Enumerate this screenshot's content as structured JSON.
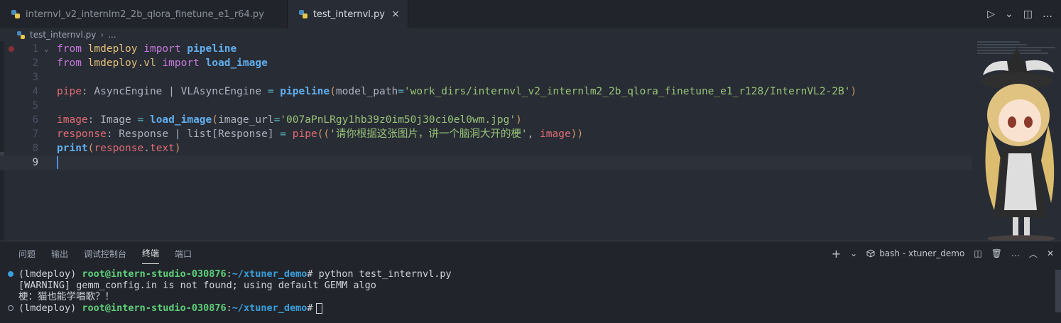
{
  "tabs": [
    {
      "label": "internvl_v2_internlm2_2b_qlora_finetune_e1_r64.py",
      "active": false
    },
    {
      "label": "test_internvl.py",
      "active": true
    }
  ],
  "tab_actions": {
    "run": "▷",
    "run_menu": "⌄",
    "split": "◫",
    "more": "…"
  },
  "tab_close": "×",
  "breadcrumb": {
    "file": "test_internvl.py",
    "sep": "›",
    "more": "..."
  },
  "editor": {
    "lines": [
      {
        "n": "1",
        "breakpoint": true,
        "fold": true,
        "tokens": [
          [
            "kw",
            "from "
          ],
          [
            "mod",
            "lmdeploy"
          ],
          [
            "kw",
            " import "
          ],
          [
            "fn",
            "pipeline"
          ]
        ]
      },
      {
        "n": "2",
        "tokens": [
          [
            "kw",
            "from "
          ],
          [
            "mod",
            "lmdeploy.vl"
          ],
          [
            "kw",
            " import "
          ],
          [
            "fn",
            "load_image"
          ]
        ]
      },
      {
        "n": "3",
        "tokens": []
      },
      {
        "n": "4",
        "tokens": [
          [
            "var",
            "pipe"
          ],
          [
            "plain",
            ": AsyncEngine | VLAsyncEngine "
          ],
          [
            "op",
            "="
          ],
          [
            "plain",
            " "
          ],
          [
            "fn",
            "pipeline"
          ],
          [
            "paren",
            "("
          ],
          [
            "param",
            "model_path"
          ],
          [
            "op",
            "="
          ],
          [
            "str",
            "'work_dirs/internvl_v2_internlm2_2b_qlora_finetune_e1_r128/InternVL2-2B'"
          ],
          [
            "paren",
            ")"
          ]
        ]
      },
      {
        "n": "5",
        "tokens": []
      },
      {
        "n": "6",
        "tokens": [
          [
            "var",
            "image"
          ],
          [
            "plain",
            ": Image "
          ],
          [
            "op",
            "="
          ],
          [
            "plain",
            " "
          ],
          [
            "fn",
            "load_image"
          ],
          [
            "paren",
            "("
          ],
          [
            "param",
            "image_url"
          ],
          [
            "op",
            "="
          ],
          [
            "str",
            "'007aPnLRgy1hb39z0im50j30ci0el0wm.jpg'"
          ],
          [
            "paren",
            ")"
          ]
        ]
      },
      {
        "n": "7",
        "tokens": [
          [
            "var",
            "response"
          ],
          [
            "plain",
            ": Response | list[Response] "
          ],
          [
            "op",
            "="
          ],
          [
            "plain",
            " "
          ],
          [
            "var",
            "pipe"
          ],
          [
            "paren",
            "(("
          ],
          [
            "str",
            "'请你根据这张图片，讲一个脑洞大开的梗'"
          ],
          [
            "plain",
            ", "
          ],
          [
            "var",
            "image"
          ],
          [
            "paren",
            "))"
          ]
        ]
      },
      {
        "n": "8",
        "tokens": [
          [
            "fn",
            "print"
          ],
          [
            "paren",
            "("
          ],
          [
            "var",
            "response"
          ],
          [
            "plain",
            "."
          ],
          [
            "var",
            "text"
          ],
          [
            "paren",
            ")"
          ]
        ]
      },
      {
        "n": "9",
        "current": true,
        "tokens": []
      }
    ]
  },
  "panel": {
    "tabs": [
      "问题",
      "输出",
      "调试控制台",
      "终端",
      "端口"
    ],
    "active_tab": "终端",
    "add_terminal": "+",
    "add_menu": "⌄",
    "terminal_name": "bash - xtuner_demo",
    "actions": {
      "split": "◫",
      "trash": "🗑",
      "more": "…",
      "maximize": "︿",
      "close": "✕"
    }
  },
  "terminal": {
    "lines": [
      {
        "dot": "filled",
        "segments": [
          [
            "plain",
            "(lmdeploy) "
          ],
          [
            "user",
            "root@intern-studio-030876"
          ],
          [
            "plain",
            ":"
          ],
          [
            "path",
            "~/xtuner_demo"
          ],
          [
            "plain",
            "# python test_internvl.py"
          ]
        ]
      },
      {
        "dot": "none",
        "segments": [
          [
            "plain",
            "[WARNING] gemm_config.in is not found; using default GEMM algo"
          ]
        ]
      },
      {
        "dot": "none",
        "segments": [
          [
            "plain",
            "梗：猫也能学唱歌？！"
          ]
        ]
      },
      {
        "dot": "hollow",
        "cursor": true,
        "segments": [
          [
            "plain",
            "(lmdeploy) "
          ],
          [
            "user",
            "root@intern-studio-030876"
          ],
          [
            "plain",
            ":"
          ],
          [
            "path",
            "~/xtuner_demo"
          ],
          [
            "plain",
            "#"
          ]
        ]
      }
    ]
  },
  "colors": {
    "accent": "#528bff",
    "background": "#282c34",
    "panel": "#21252b"
  }
}
